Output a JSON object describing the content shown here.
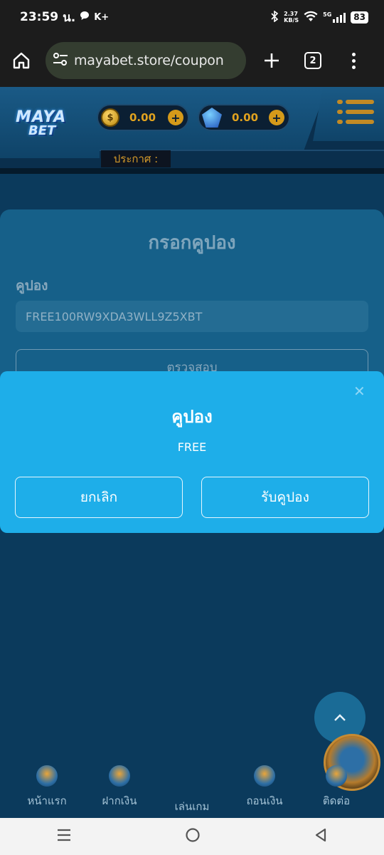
{
  "status_bar": {
    "time": "23:59",
    "suffix": "น.",
    "carrier": "K+",
    "speed_top": "2.37",
    "speed_bottom": "KB/S",
    "network": "5G",
    "battery": "83"
  },
  "browser": {
    "url": "mayabet.store/coupon",
    "tab_count": "2"
  },
  "header": {
    "logo_line1": "MAYA",
    "logo_line2": "BET",
    "wallet_coin": "0.00",
    "wallet_gem": "0.00",
    "announce_label": "ประกาศ :"
  },
  "coupon_form": {
    "title": "กรอกคูปอง",
    "field_label": "คูปอง",
    "field_value": "FREE100RW9XDA3WLL9Z5XBT",
    "check_button": "ตรวจสอบ"
  },
  "modal": {
    "title": "คูปอง",
    "message": "FREE",
    "cancel_label": "ยกเลิก",
    "claim_label": "รับคูปอง"
  },
  "bottom_nav": {
    "items": [
      {
        "label": "หน้าแรก"
      },
      {
        "label": "ฝากเงิน"
      },
      {
        "label": "เล่นเกม"
      },
      {
        "label": "ถอนเงิน"
      },
      {
        "label": "ติดต่อ"
      }
    ]
  },
  "colors": {
    "page_bg": "#0b3a5c",
    "modal_bg": "#1eaee9",
    "accent_gold": "#d49a2a"
  },
  "icons": {
    "browser_home": "home-icon",
    "site_settings": "tune-icon",
    "new_tab": "plus-icon",
    "overflow": "more-vert-icon",
    "scroll_top": "chevron-up-icon"
  }
}
